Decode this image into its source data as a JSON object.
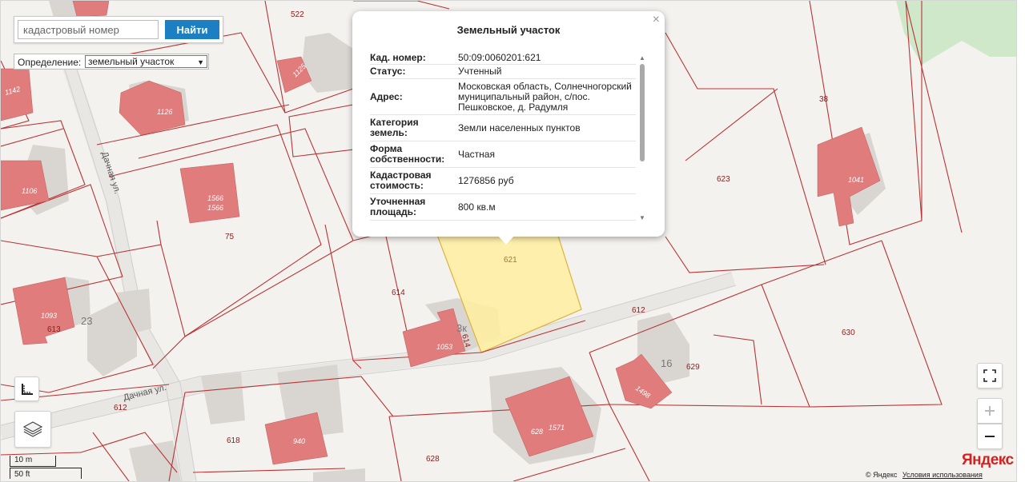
{
  "search": {
    "placeholder": "кадастровый номер",
    "value": "",
    "button_label": "Найти"
  },
  "definition": {
    "label": "Определение:",
    "selected": "земельный участок"
  },
  "popup": {
    "title": "Земельный участок",
    "close_glyph": "×",
    "rows": [
      {
        "key": "Кад. номер:",
        "value": "50:09:0060201:621"
      },
      {
        "key": "Статус:",
        "value": "Учтенный"
      },
      {
        "key": "Адрес:",
        "value": "Московская область, Солнечногорский муниципальный район, с/пос. Пешковское, д. Радумля"
      },
      {
        "key": "Категория земель:",
        "value": "Земли населенных пунктов"
      },
      {
        "key": "Форма собственности:",
        "value": "Частная"
      },
      {
        "key": "Кадастровая стоимость:",
        "value": "1276856 руб"
      },
      {
        "key": "Уточненная площадь:",
        "value": "800 кв.м"
      }
    ]
  },
  "map": {
    "plot_labels": [
      "522",
      "38",
      "623",
      "75",
      "621",
      "614",
      "612",
      "630",
      "613",
      "629",
      "618",
      "628",
      "612",
      "1142"
    ],
    "building_labels": [
      "1125",
      "1126",
      "1106",
      "1566",
      "1566",
      "1041",
      "1093",
      "1053",
      "1498",
      "628",
      "1571",
      "940"
    ],
    "house_numbers": [
      "23",
      "16",
      "3к"
    ],
    "streets": [
      "Дачная ул.",
      "Дачная ул."
    ],
    "edge_labels": [
      "614"
    ]
  },
  "scale": {
    "metric": "10 m",
    "imperial": "50 ft"
  },
  "branding": {
    "logo": "Яндекс",
    "copyright": "© Яндекс",
    "terms_link": "Условия использования"
  },
  "colors": {
    "parcel_border": "#b83434",
    "building": "#e07c7c",
    "selected_parcel": "#fff0a0",
    "accent": "#1b7fc2"
  },
  "icons": {
    "ruler": "ruler-icon",
    "layers": "layers-icon",
    "fullscreen": "fullscreen-icon",
    "zoom_in": "zoom-in-icon",
    "zoom_out": "zoom-out-icon"
  }
}
